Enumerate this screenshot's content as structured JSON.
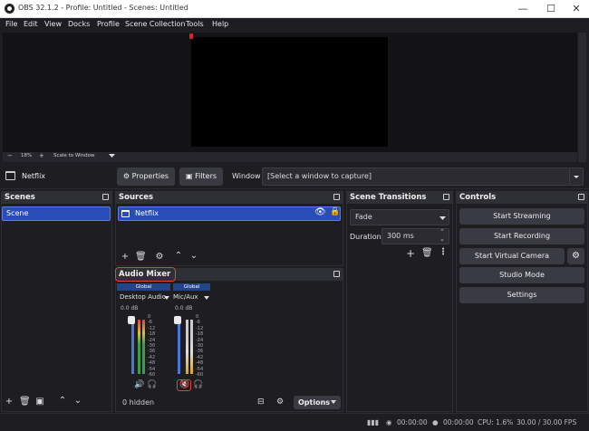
{
  "window": {
    "title": "OBS 32.1.2 - Profile: Untitled - Scenes: Untitled",
    "minimize": "—",
    "maximize": "☐",
    "close": "✕"
  },
  "menu": [
    "File",
    "Edit",
    "View",
    "Docks",
    "Profile",
    "Scene Collection",
    "Tools",
    "Help"
  ],
  "preview_bar": {
    "minus": "−",
    "zoom": "18%",
    "plus": "+",
    "scale_mode": "Scale to Window"
  },
  "context": {
    "source_name": "Netflix",
    "properties_label": "Properties",
    "filters_label": "Filters",
    "window_label": "Window",
    "window_value": "[Select a window to capture]"
  },
  "scenes": {
    "title": "Scenes",
    "items": [
      "Scene"
    ]
  },
  "sources": {
    "title": "Sources",
    "items": [
      "Netflix"
    ]
  },
  "transitions": {
    "title": "Scene Transitions",
    "transition": "Fade",
    "duration_label": "Duration",
    "duration_value": "300 ms"
  },
  "controls": {
    "title": "Controls",
    "buttons": [
      "Start Streaming",
      "Start Recording",
      "Start Virtual Camera",
      "Studio Mode",
      "Settings"
    ]
  },
  "mixer": {
    "title": "Audio Mixer",
    "channels": [
      {
        "scope": "Global",
        "name": "Desktop Audio",
        "db": "0.0 dB",
        "level": 0.85,
        "muted": false
      },
      {
        "scope": "Global",
        "name": "Mic/Aux",
        "db": "0.0 dB",
        "level": 0.85,
        "muted": true
      }
    ],
    "scale": [
      "0",
      "-6",
      "-12",
      "-18",
      "-24",
      "-30",
      "-36",
      "-42",
      "-48",
      "-54",
      "-60"
    ],
    "hidden_label": "0 hidden",
    "options_label": "Options"
  },
  "status": {
    "stream_time": "00:00:00",
    "record_time": "00:00:00",
    "cpu": "CPU: 1.6%",
    "fps": "30.00 / 30.00 FPS"
  },
  "colors": {
    "accent": "#284cb8",
    "highlight_box": "#e0443a"
  }
}
